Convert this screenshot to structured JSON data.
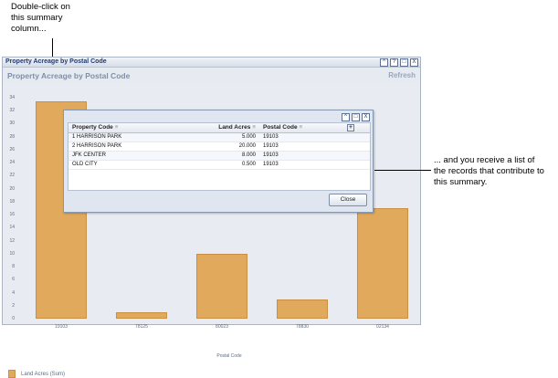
{
  "callouts": {
    "top": [
      "Double-click on",
      "this summary",
      "column..."
    ],
    "right": [
      "... and you receive a list of",
      "the records that contribute to",
      "this summary."
    ]
  },
  "window": {
    "title": "Property Acreage by Postal Code",
    "controls": [
      "^",
      "?",
      "□",
      "X"
    ]
  },
  "panel": {
    "title": "Property Acreage by Postal Code",
    "refresh_label": "Refresh"
  },
  "chart_data": {
    "type": "bar",
    "categories": [
      "19103",
      "78125",
      "80023",
      "78830",
      "02134"
    ],
    "values": [
      33.5,
      1.0,
      10.0,
      3.0,
      17.0
    ],
    "ylim": [
      0,
      34
    ],
    "yticks": [
      "0",
      "2",
      "4",
      "6",
      "8",
      "10",
      "12",
      "14",
      "16",
      "18",
      "20",
      "22",
      "24",
      "26",
      "28",
      "30",
      "32",
      "34"
    ],
    "xlabel": "Postal Code",
    "ylabel": "",
    "legend": "Land Acres (Sum)",
    "bar_color": "#e0a95c"
  },
  "popup": {
    "controls": [
      "^",
      "□",
      "X"
    ],
    "headers": {
      "property": "Property Code",
      "acres": "Land Acres",
      "postal": "Postal Code"
    },
    "rows": [
      {
        "property": "1 HARRISON PARK",
        "acres": "5.000",
        "postal": "19103"
      },
      {
        "property": "2 HARRISON PARK",
        "acres": "20.000",
        "postal": "19103"
      },
      {
        "property": "JFK CENTER",
        "acres": "8.000",
        "postal": "19103"
      },
      {
        "property": "OLD CITY",
        "acres": "0.500",
        "postal": "19103"
      }
    ],
    "close_label": "Close"
  }
}
